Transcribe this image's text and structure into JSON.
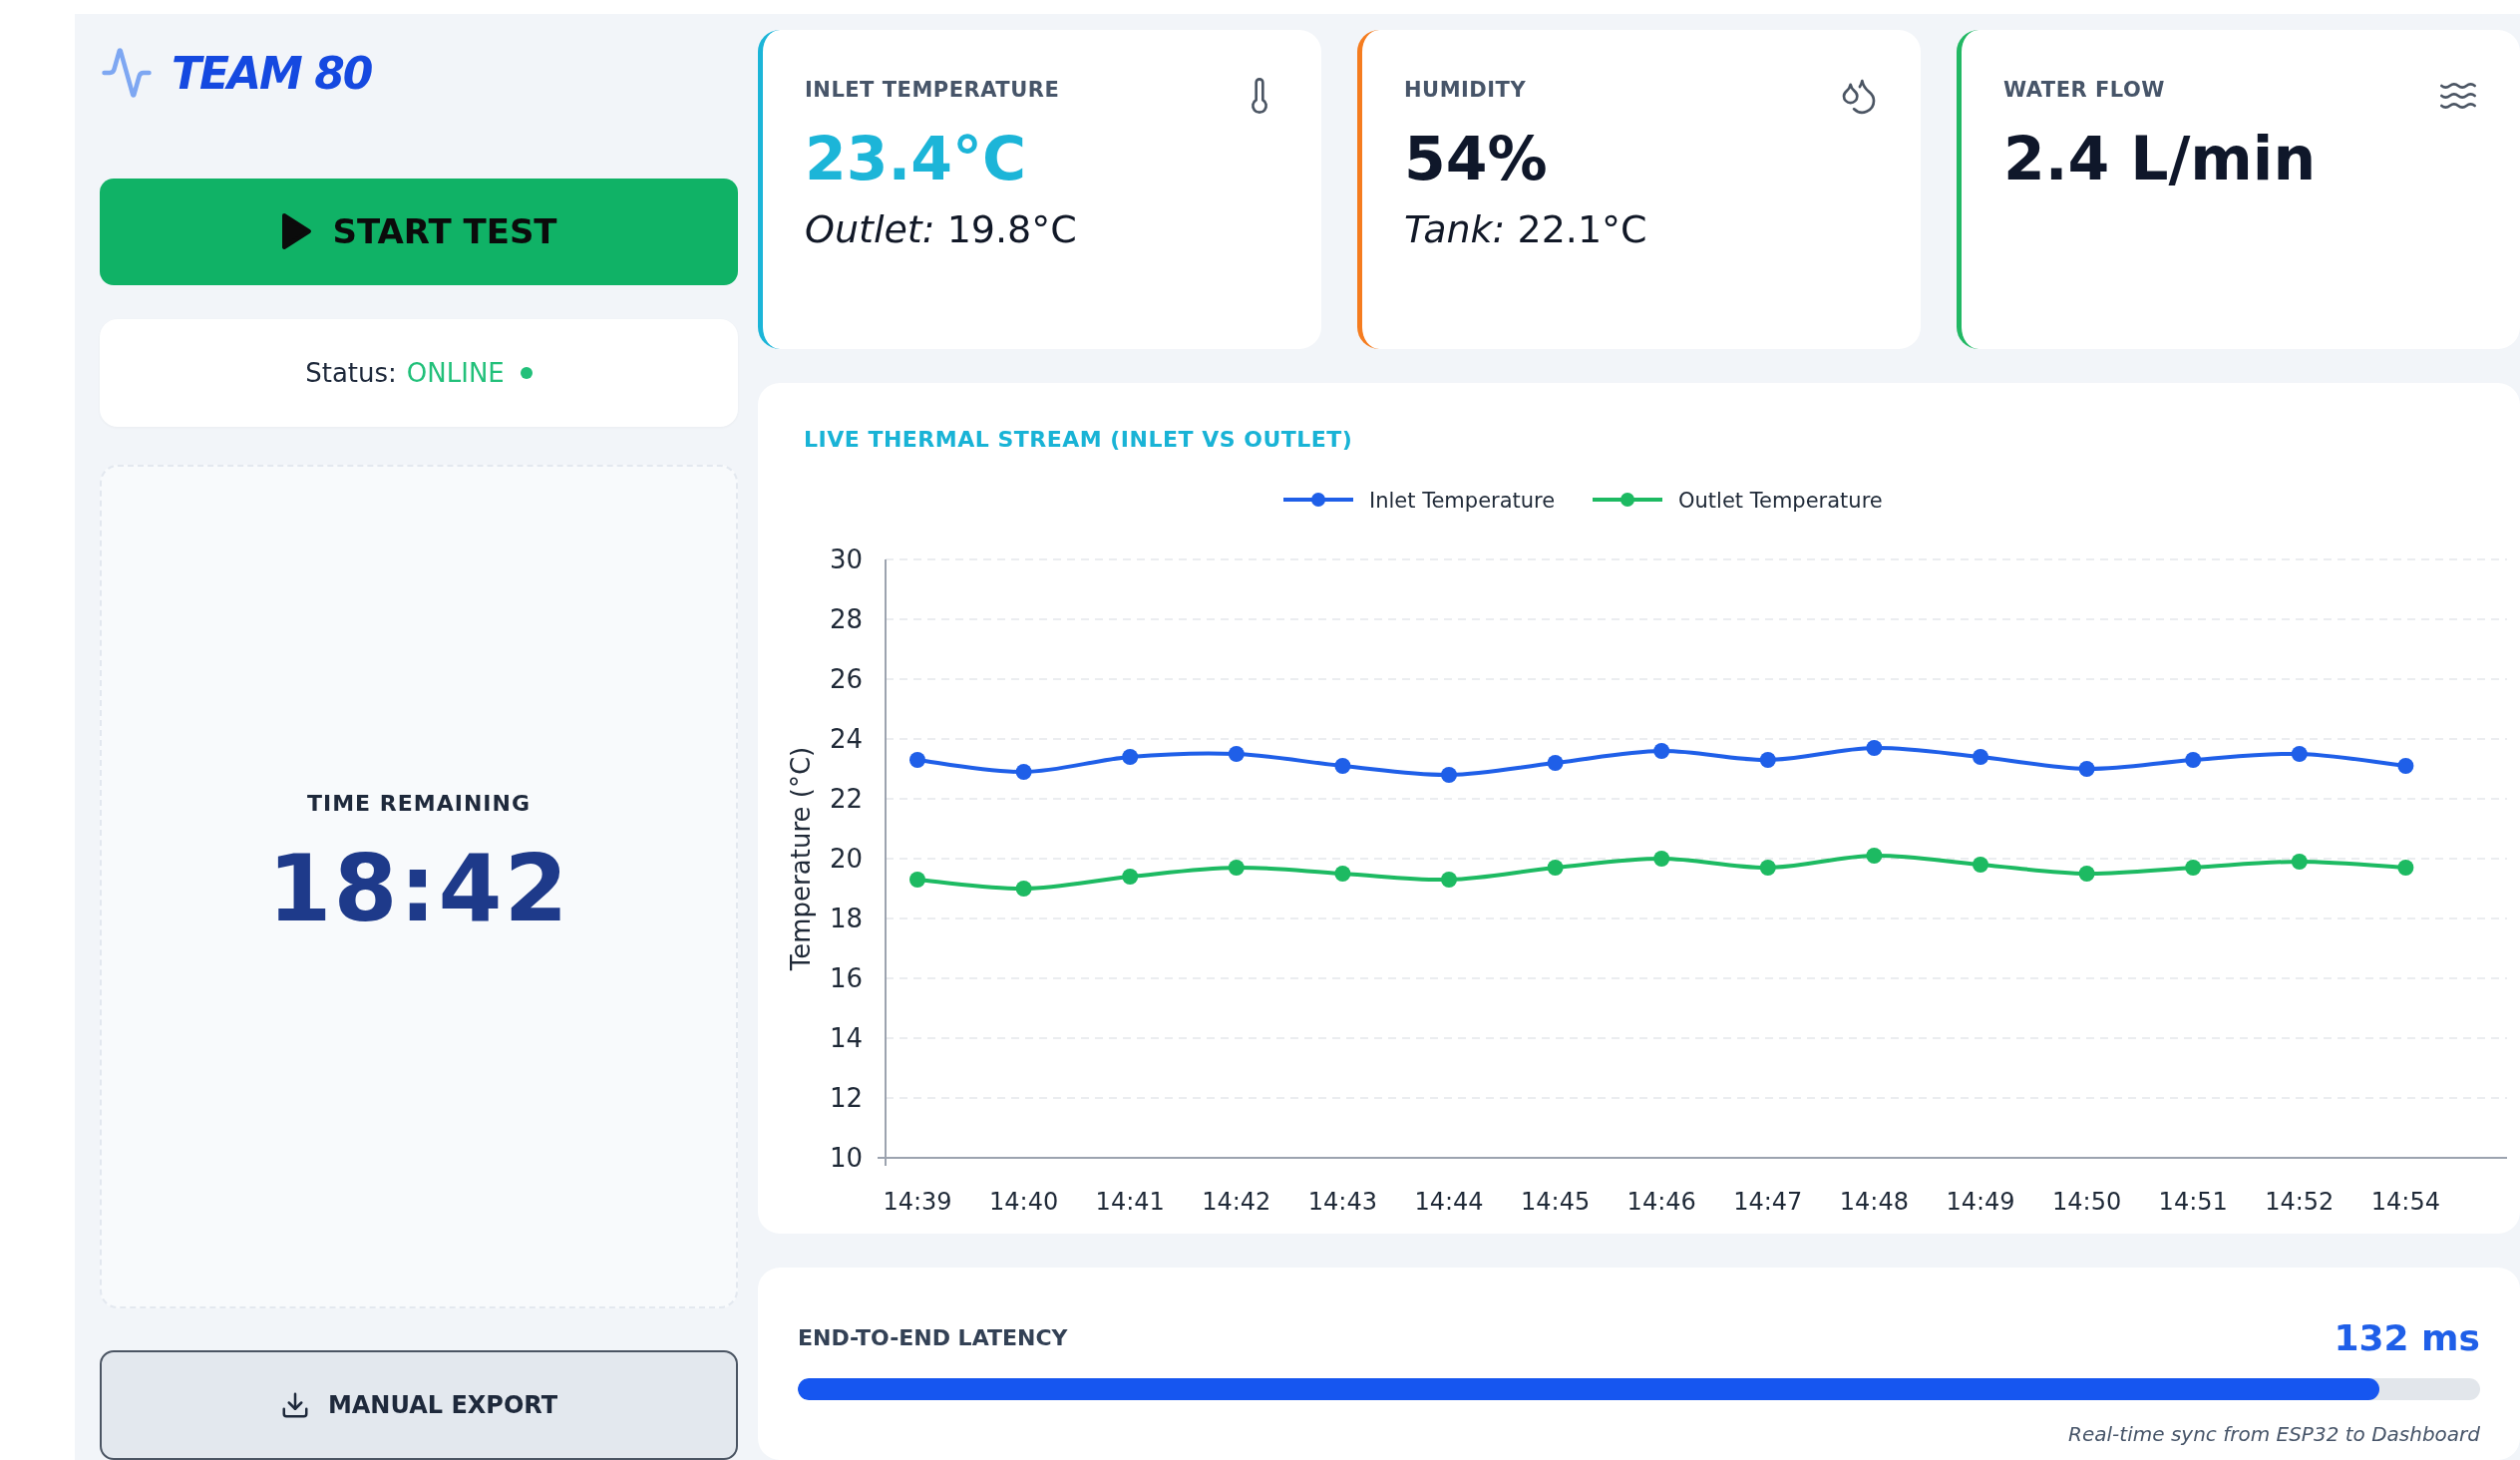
{
  "brand": {
    "name": "TEAM 80"
  },
  "start_button": {
    "label": "START TEST"
  },
  "status": {
    "label": "Status:",
    "value": "ONLINE",
    "online": true
  },
  "timer": {
    "label": "TIME REMAINING",
    "value": "18:42"
  },
  "export_button": {
    "label": "MANUAL EXPORT"
  },
  "cards": [
    {
      "kind": "temperature",
      "title": "INLET TEMPERATURE",
      "value": "23.4°C",
      "value_colored": true,
      "color": "#1cb5d8",
      "sub": {
        "label": "Outlet:",
        "value": "19.8°C"
      }
    },
    {
      "kind": "humidity",
      "title": "HUMIDITY",
      "value": "54%",
      "value_colored": false,
      "color": "#f57c1f",
      "sub": {
        "label": "Tank:",
        "value": "22.1°C"
      }
    },
    {
      "kind": "flow",
      "title": "WATER FLOW",
      "value": "2.4 L/min",
      "value_colored": false,
      "color": "#22b864"
    }
  ],
  "chart": {
    "title": "LIVE THERMAL STREAM (INLET VS OUTLET)",
    "chart_data": {
      "type": "line",
      "grid": {
        "y": true,
        "x": false
      },
      "legend": true,
      "ylabel": "Temperature (°C)",
      "categories": [
        "14:39",
        "14:40",
        "14:41",
        "14:42",
        "14:43",
        "14:44",
        "14:45",
        "14:46",
        "14:47",
        "14:48",
        "14:49",
        "14:50",
        "14:51",
        "14:52",
        "14:54"
      ],
      "ylim": [
        10,
        30
      ],
      "yticks": [
        10,
        12,
        14,
        16,
        18,
        20,
        22,
        24,
        26,
        28,
        30
      ],
      "series": [
        {
          "name": "Inlet Temperature",
          "color": "#1f5fe8",
          "marker": "circle",
          "values": [
            23.3,
            22.9,
            23.4,
            23.5,
            23.1,
            22.8,
            23.2,
            23.6,
            23.3,
            23.7,
            23.4,
            23.0,
            23.3,
            23.5,
            23.1
          ]
        },
        {
          "name": "Outlet Temperature",
          "color": "#1dba62",
          "marker": "circle",
          "values": [
            19.3,
            19.0,
            19.4,
            19.7,
            19.5,
            19.3,
            19.7,
            20.0,
            19.7,
            20.1,
            19.8,
            19.5,
            19.7,
            19.9,
            19.7
          ]
        }
      ]
    }
  },
  "latency": {
    "label": "END-TO-END LATENCY",
    "value": "132 ms",
    "level": 0.94,
    "note": "Real-time sync from ESP32 to Dashboard"
  }
}
